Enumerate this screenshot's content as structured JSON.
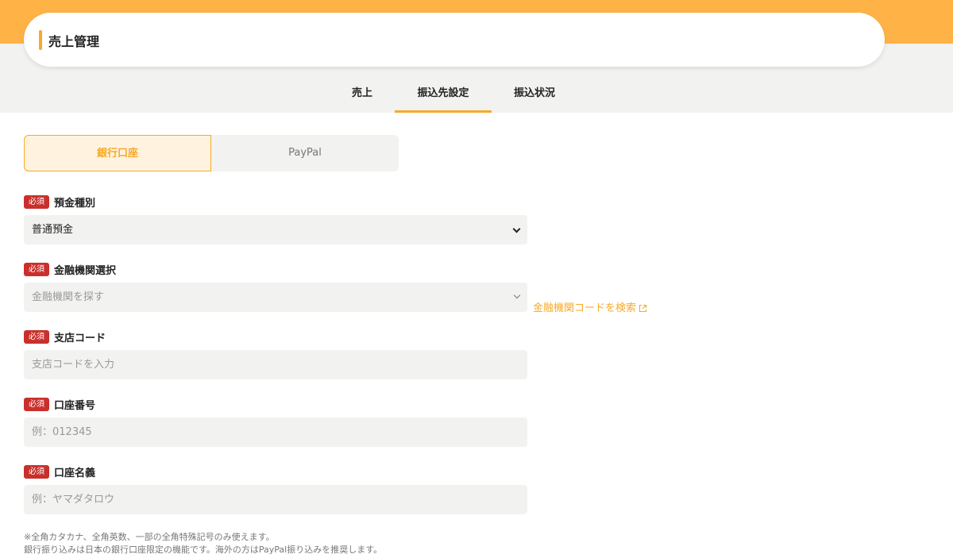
{
  "header": {
    "title": "売上管理"
  },
  "tabs": [
    {
      "label": "売上",
      "active": false
    },
    {
      "label": "振込先設定",
      "active": true
    },
    {
      "label": "振込状況",
      "active": false
    }
  ],
  "payment_methods": [
    {
      "label": "銀行口座",
      "selected": true
    },
    {
      "label": "PayPal",
      "selected": false
    }
  ],
  "required_badge": "必須",
  "form": {
    "account_type": {
      "label": "預金種別",
      "value": "普通預金"
    },
    "bank": {
      "label": "金融機関選択",
      "placeholder": "金融機関を探す",
      "search_link": "金融機関コードを検索"
    },
    "branch_code": {
      "label": "支店コード",
      "placeholder": "支店コードを入力"
    },
    "account_number": {
      "label": "口座番号",
      "placeholder": "例：012345"
    },
    "account_name": {
      "label": "口座名義",
      "placeholder": "例：ヤマダタロウ"
    }
  },
  "notes": [
    "※全角カタカナ、全角英数、一部の全角特殊記号のみ使えます。",
    "銀行振り込みは日本の銀行口座限定の機能です。海外の方はPayPal振り込みを推奨します。"
  ],
  "colors": {
    "accent": "#f7a928",
    "top_band": "#ffb347",
    "required": "#c9302c",
    "field_bg": "#f2f2f1"
  }
}
